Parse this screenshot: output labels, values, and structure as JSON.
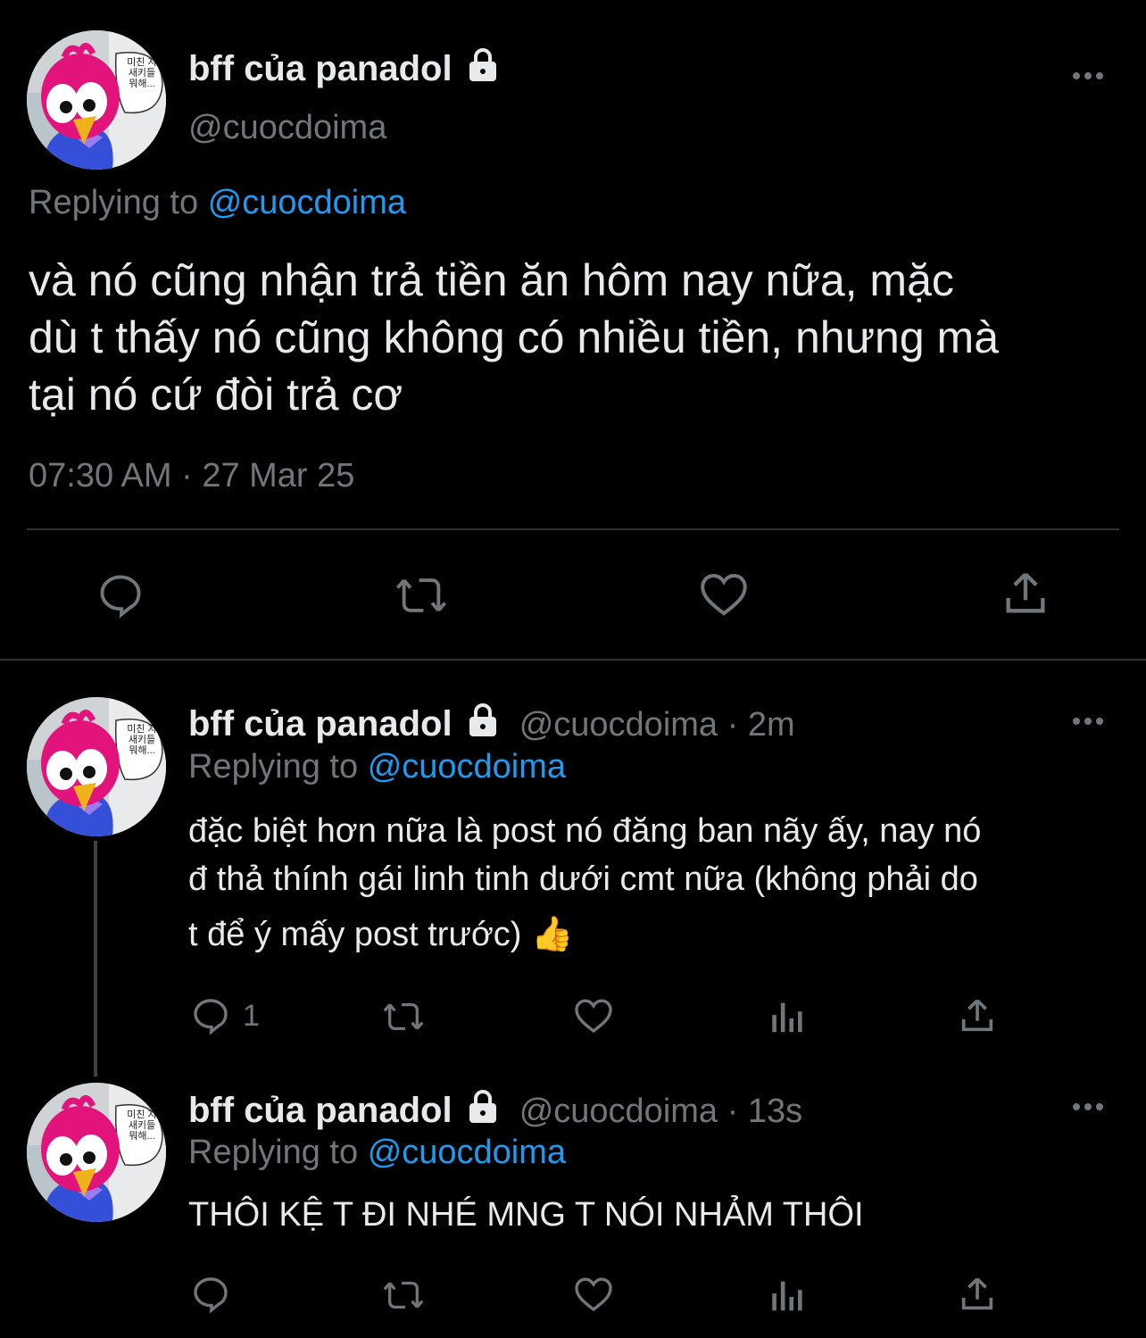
{
  "main_tweet": {
    "display_name": "bff của panadol",
    "handle": "@cuocdoima",
    "replying_label": "Replying to",
    "replying_handle": "@cuocdoima",
    "text_lines": [
      "và nó cũng nhận trả tiền ăn hôm nay nữa, mặc",
      "dù t thấy nó cũng không có nhiều tiền, nhưng mà",
      "tại nó cứ đòi trả cơ"
    ],
    "timestamp": "07:30 AM · 27 Mar 25"
  },
  "reply1": {
    "display_name": "bff của panadol",
    "meta": "@cuocdoima · 2m",
    "replying_label": "Replying to",
    "replying_handle": "@cuocdoima",
    "text_lines": [
      "đặc biệt hơn nữa là post nó đăng ban nãy ấy, nay nó",
      "đ thả thính gái linh tinh dưới cmt nữa (không phải do",
      "t để ý mấy post trước) 👍"
    ],
    "reply_count": "1"
  },
  "reply2": {
    "display_name": "bff của panadol",
    "meta": "@cuocdoima · 13s",
    "replying_label": "Replying to",
    "replying_handle": "@cuocdoima",
    "text_lines": [
      "THÔI KỆ T ĐI NHÉ MNG T NÓI NHẢM THÔI"
    ]
  },
  "avatar_caption": [
    "미친 자",
    "새키들",
    "뭐해..."
  ],
  "colors": {
    "background": "#000000",
    "text": "#e7e9ea",
    "secondary": "#71767b",
    "accent": "#1d9bf0"
  },
  "icons": {
    "lock": "lock-icon",
    "more": "more-icon",
    "reply": "reply-icon",
    "retweet": "retweet-icon",
    "like": "heart-icon",
    "views": "analytics-icon",
    "share": "share-icon"
  }
}
